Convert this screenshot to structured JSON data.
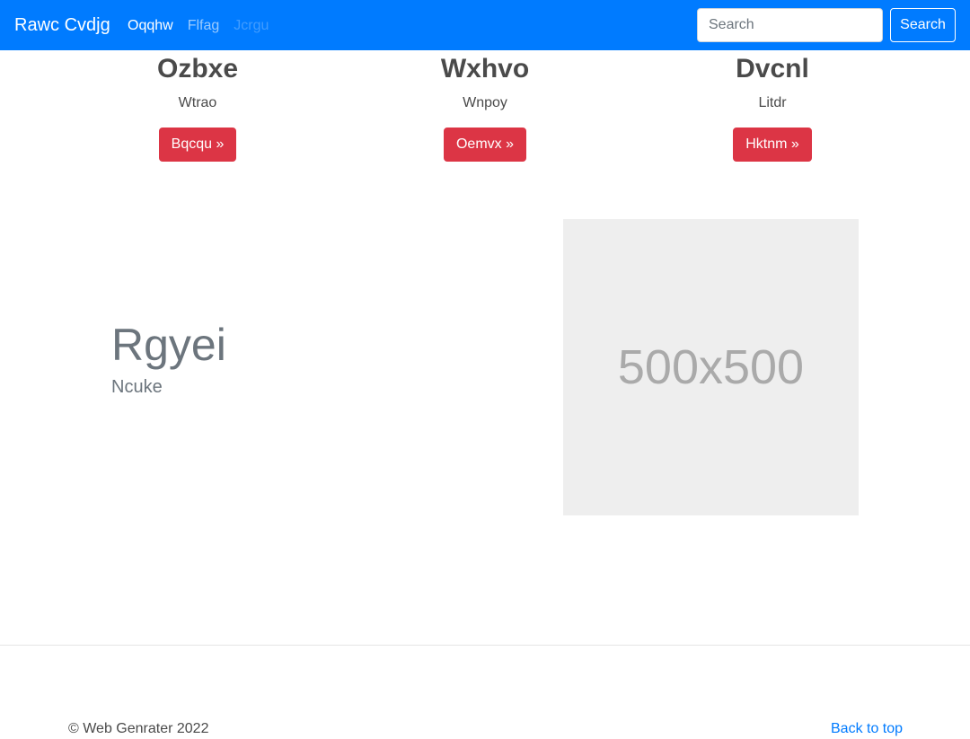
{
  "navbar": {
    "brand": "Rawc Cvdjg",
    "links": [
      {
        "label": "Oqqhw",
        "state": "active"
      },
      {
        "label": "Flfag",
        "state": "normal"
      },
      {
        "label": "Jcrgu",
        "state": "disabled"
      }
    ],
    "search_placeholder": "Search",
    "search_button": "Search",
    "background_color": "#007bff"
  },
  "features": [
    {
      "title": "Ozbxe",
      "text": "Wtrao",
      "button": "Bqcqu »"
    },
    {
      "title": "Wxhvo",
      "text": "Wnpoy",
      "button": "Oemvx »"
    },
    {
      "title": "Dvcnl",
      "text": "Litdr",
      "button": "Hktnm »"
    }
  ],
  "hero": {
    "title": "Rgyei",
    "subtitle": "Ncuke",
    "image_label": "500x500"
  },
  "footer": {
    "copyright": "© Web Genrater 2022",
    "back_to_top": "Back to top"
  },
  "colors": {
    "primary": "#007bff",
    "danger": "#dc3545",
    "placeholder_bg": "#eeeeee"
  }
}
